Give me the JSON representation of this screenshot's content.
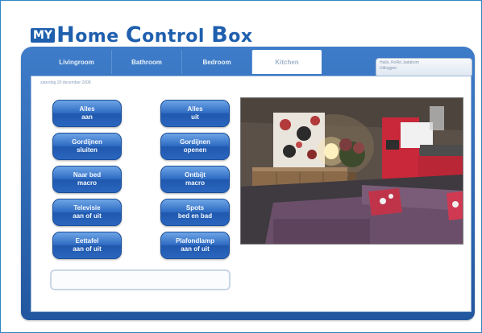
{
  "logo": {
    "badge": "MY",
    "word1_cap": "H",
    "word1_rest": "ome ",
    "word2_cap": "C",
    "word2_rest": "ontrol ",
    "word3_cap": "B",
    "word3_rest": "ox"
  },
  "tabs": [
    {
      "label": "Livingroom"
    },
    {
      "label": "Bathroom"
    },
    {
      "label": "Bedroom"
    },
    {
      "label": "Kitchen",
      "active": true
    }
  ],
  "user_box": {
    "line1": "Hallo, RoRd Jadabom",
    "line2": "Uitloggen"
  },
  "status_text": "zaterdag 20 december 2008",
  "buttons": [
    {
      "line1": "Alles",
      "line2": "aan"
    },
    {
      "line1": "Alles",
      "line2": "uit"
    },
    {
      "line1": "Gordijnen",
      "line2": "sluiten"
    },
    {
      "line1": "Gordijnen",
      "line2": "openen"
    },
    {
      "line1": "Naar bed",
      "line2": "macro"
    },
    {
      "line1": "Ontbijt",
      "line2": "macro"
    },
    {
      "line1": "Televisie",
      "line2": "aan of uit"
    },
    {
      "line1": "Spots",
      "line2": "bed en bad"
    },
    {
      "line1": "Eettafel",
      "line2": "aan of uit"
    },
    {
      "line1": "Plafondlamp",
      "line2": "aan of uit"
    }
  ],
  "colors": {
    "brand": "#1f5fae",
    "panel": "#2e6cc3",
    "frame": "#2f86c6"
  }
}
